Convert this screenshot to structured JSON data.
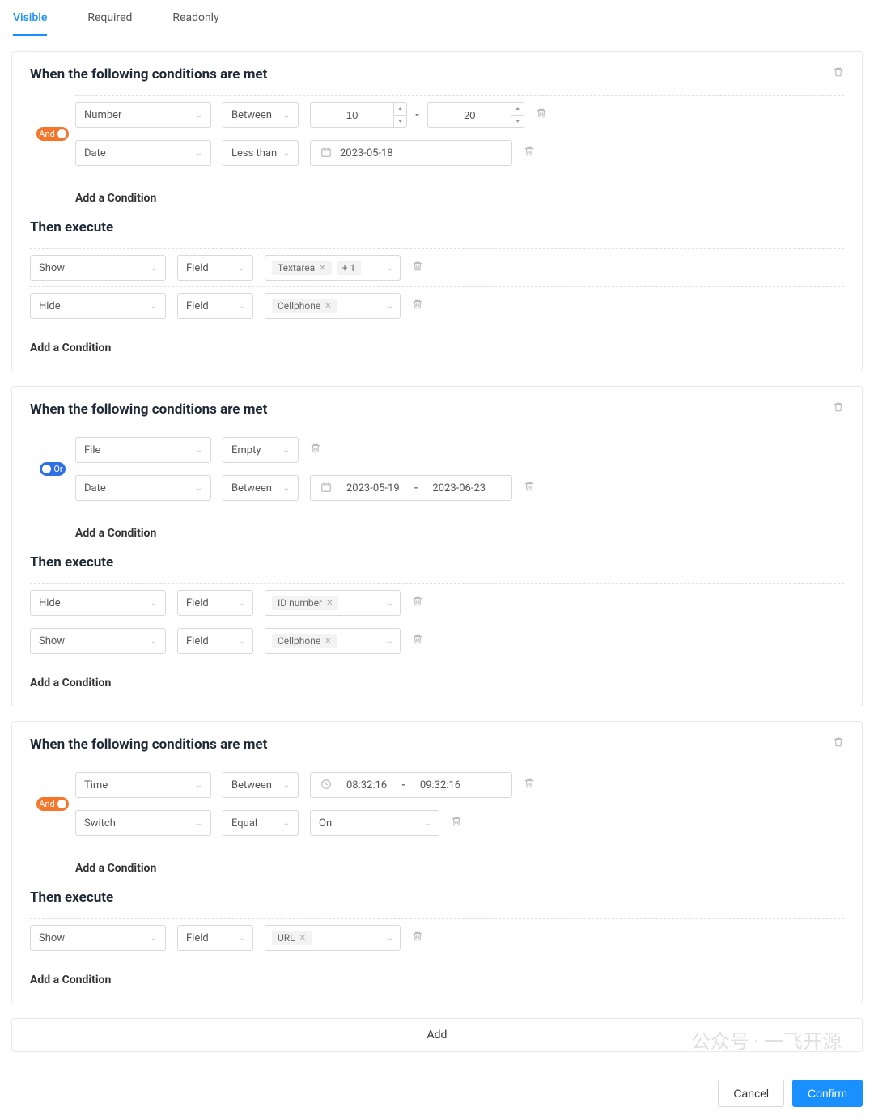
{
  "tabs": [
    "Visible",
    "Required",
    "Readonly"
  ],
  "labels": {
    "when": "When the following conditions are met",
    "then": "Then execute",
    "addCondition": "Add a Condition",
    "add": "Add",
    "cancel": "Cancel",
    "confirm": "Confirm"
  },
  "blocks": [
    {
      "logic": "And",
      "conditions": [
        {
          "type": "numrange",
          "field": "Number",
          "op": "Between",
          "from": "10",
          "to": "20"
        },
        {
          "type": "date",
          "field": "Date",
          "op": "Less than",
          "value": "2023-05-18"
        }
      ],
      "actions": [
        {
          "action": "Show",
          "target": "Field",
          "tags": [
            "Textarea"
          ],
          "extra": "+ 1"
        },
        {
          "action": "Hide",
          "target": "Field",
          "tags": [
            "Cellphone"
          ]
        }
      ]
    },
    {
      "logic": "Or",
      "conditions": [
        {
          "type": "plain",
          "field": "File",
          "op": "Empty"
        },
        {
          "type": "daterange",
          "field": "Date",
          "op": "Between",
          "from": "2023-05-19",
          "to": "2023-06-23"
        }
      ],
      "actions": [
        {
          "action": "Hide",
          "target": "Field",
          "tags": [
            "ID number"
          ]
        },
        {
          "action": "Show",
          "target": "Field",
          "tags": [
            "Cellphone"
          ]
        }
      ]
    },
    {
      "logic": "And",
      "conditions": [
        {
          "type": "timerange",
          "field": "Time",
          "op": "Between",
          "from": "08:32:16",
          "to": "09:32:16"
        },
        {
          "type": "switch",
          "field": "Switch",
          "op": "Equal",
          "value": "On"
        }
      ],
      "actions": [
        {
          "action": "Show",
          "target": "Field",
          "tags": [
            "URL"
          ]
        }
      ]
    }
  ],
  "watermark": "公众号 · 一飞开源"
}
